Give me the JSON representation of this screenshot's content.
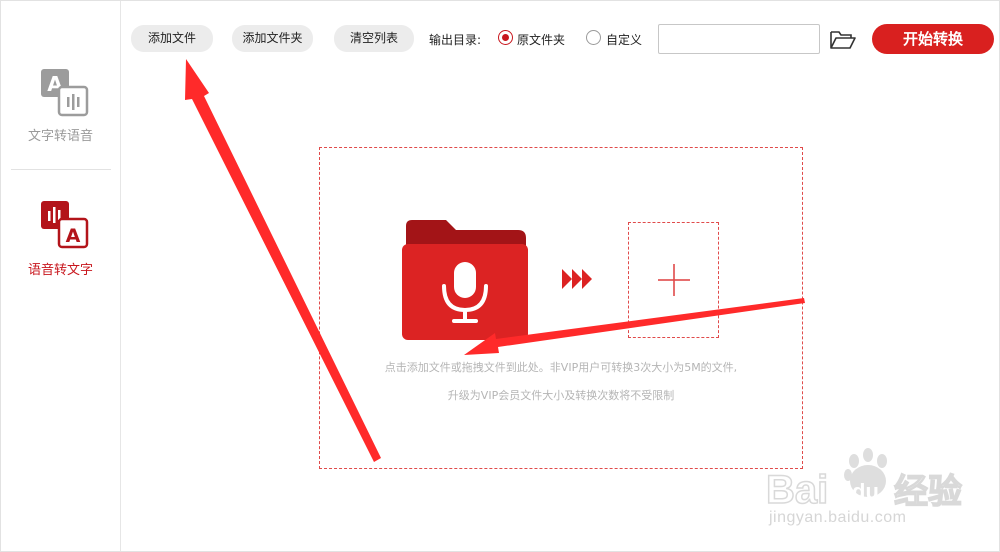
{
  "sidebar": {
    "items": [
      {
        "label": "文字转语音",
        "icon": "text-to-speech-icon",
        "active": false
      },
      {
        "label": "语音转文字",
        "icon": "speech-to-text-icon",
        "active": true
      }
    ]
  },
  "toolbar": {
    "add_file": "添加文件",
    "add_folder": "添加文件夹",
    "clear_list": "清空列表",
    "output_dir_label": "输出目录:",
    "radio_original": "原文件夹",
    "radio_custom": "自定义",
    "output_path_value": "",
    "start": "开始转换",
    "selected_output": "原文件夹"
  },
  "drop_zone": {
    "hint_line1": "点击添加文件或拖拽文件到此处。非VIP用户可转换3次大小为5M的文件,",
    "hint_line2": "升级为VIP会员文件大小及转换次数将不受限制",
    "folder_icon": "microphone-folder-icon",
    "arrow_icon": "triple-chevron-right-icon",
    "add_icon": "plus-icon"
  },
  "watermark": {
    "brand_text": "Baidu经验",
    "url": "jingyan.baidu.com"
  },
  "colors": {
    "accent": "#d9201f",
    "active_text": "#c8161d",
    "hint_text": "#b5b5b5",
    "annotation_arrow": "#ff2a2a"
  }
}
